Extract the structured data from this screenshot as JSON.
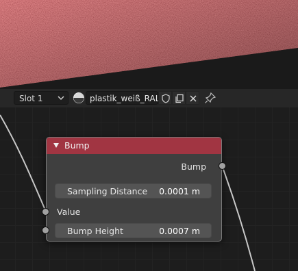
{
  "header": {
    "slot_label": "Slot 1",
    "material_name": "plastik_weiß_RAL...",
    "icons": [
      "chevron-down-icon",
      "material-sphere-icon",
      "shield-icon",
      "duplicate-icon",
      "close-icon",
      "pin-icon"
    ]
  },
  "node": {
    "title": "Bump",
    "header_color": "#a13542",
    "output_label": "Bump",
    "input_label": "Value",
    "fields": [
      {
        "label": "Sampling Distance",
        "value": "0.0001 m"
      },
      {
        "label": "Bump Height",
        "value": "0.0007 m"
      }
    ]
  },
  "colors": {
    "viewport_surface": "#8e1d24",
    "editor_background": "#1d1d1d",
    "socket_gray": "#a1a1a1"
  }
}
